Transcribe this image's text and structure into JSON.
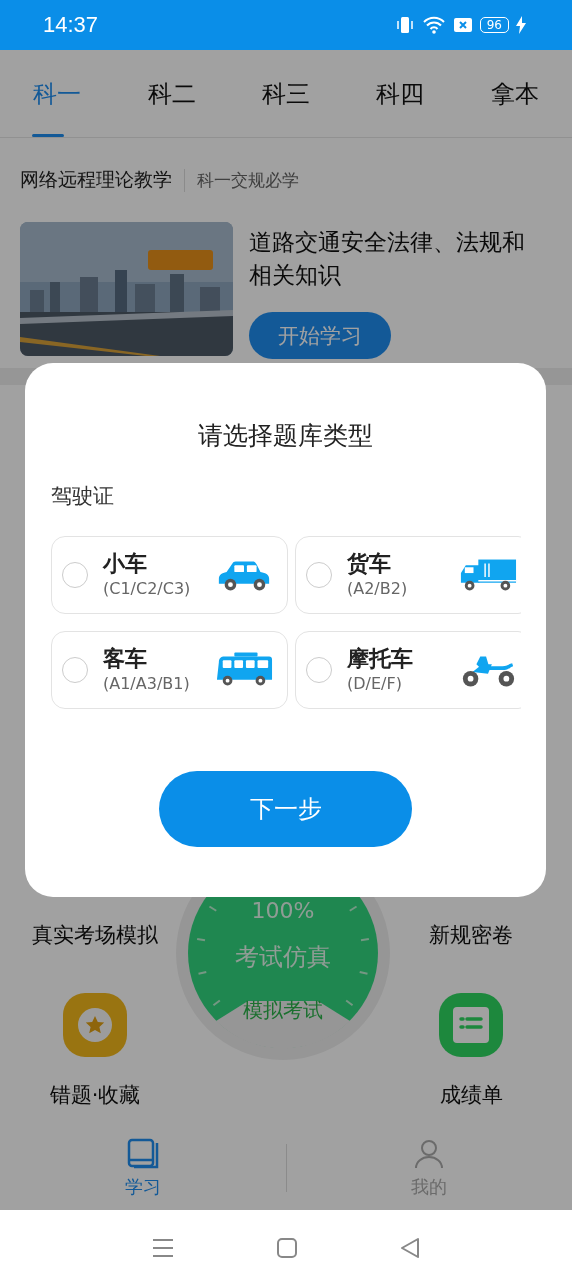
{
  "status_bar": {
    "time": "14:37",
    "battery": "96"
  },
  "tabs": [
    {
      "label": "科一",
      "selected": true
    },
    {
      "label": "科二",
      "selected": false
    },
    {
      "label": "科三",
      "selected": false
    },
    {
      "label": "科四",
      "selected": false
    },
    {
      "label": "拿本",
      "selected": false
    }
  ],
  "section": {
    "title": "网络远程理论教学",
    "subtitle": "科一交规必学"
  },
  "course": {
    "title": "道路交通安全法律、法规和相关知识",
    "button": "开始学习"
  },
  "exam_menu": {
    "left_label": "真实考场模拟",
    "right_label": "新规密卷",
    "gauge": {
      "percent": "100%",
      "title": "考试仿真",
      "button": "模拟考试"
    },
    "shortcuts": [
      {
        "label": "错题·收藏"
      },
      {
        "label": "成绩单"
      }
    ]
  },
  "bottom_nav": [
    {
      "label": "学习",
      "selected": true
    },
    {
      "label": "我的",
      "selected": false
    }
  ],
  "dialog": {
    "title": "请选择题库类型",
    "group_label": "驾驶证",
    "options": [
      {
        "name": "小车",
        "codes": "(C1/C2/C3)",
        "selected": false
      },
      {
        "name": "货车",
        "codes": "(A2/B2)",
        "selected": false
      },
      {
        "name": "客车",
        "codes": "(A1/A3/B1)",
        "selected": false
      },
      {
        "name": "摩托车",
        "codes": "(D/E/F)",
        "selected": false
      }
    ],
    "next_button": "下一步"
  }
}
